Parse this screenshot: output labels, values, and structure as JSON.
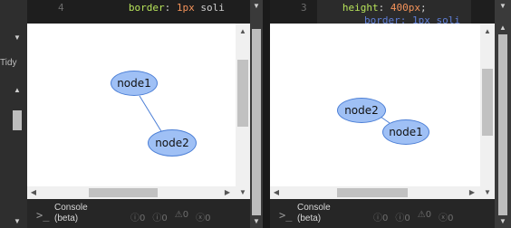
{
  "toolbar": {
    "tidy_label": "Tidy"
  },
  "left_panel": {
    "code": {
      "line_number": "4",
      "property": "border",
      "value_num": "1px",
      "value_rest": " soli"
    },
    "graph": {
      "node_a": "node1",
      "node_b": "node2"
    },
    "console": {
      "prompt": ">_",
      "label_line1": "Console",
      "label_line2": "(beta)",
      "counters": [
        "0",
        "0",
        "0",
        "0"
      ]
    }
  },
  "right_panel": {
    "code": {
      "line_number": "3",
      "property": "height",
      "value_num": "400px",
      "value_rest": ";",
      "next_line_partial": "border: 1px soli"
    },
    "graph": {
      "node_a": "node2",
      "node_b": "node1"
    },
    "console": {
      "prompt": ">_",
      "label_line1": "Console",
      "label_line2": "(beta)",
      "counters": [
        "0",
        "0",
        "0",
        "0"
      ]
    }
  }
}
